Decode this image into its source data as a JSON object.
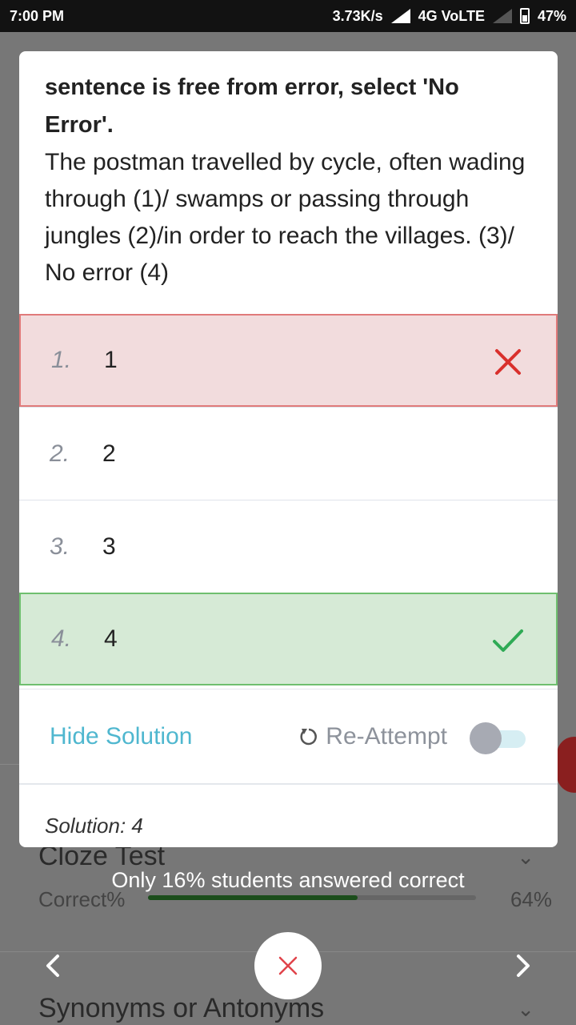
{
  "status_bar": {
    "time": "7:00 PM",
    "speed": "3.73K/s",
    "network": "4G VoLTE",
    "battery": "47%"
  },
  "question": {
    "instruction_partial": "sentence is free from error, select 'No Error'.",
    "text": "The postman travelled by cycle, often wading through (1)/ swamps or passing through jungles (2)/in order to reach the villages. (3)/ No error (4)"
  },
  "options": [
    {
      "number": "1.",
      "value": "1",
      "state": "wrong"
    },
    {
      "number": "2.",
      "value": "2",
      "state": "neutral"
    },
    {
      "number": "3.",
      "value": "3",
      "state": "neutral"
    },
    {
      "number": "4.",
      "value": "4",
      "state": "correct"
    }
  ],
  "controls": {
    "hide_solution": "Hide Solution",
    "reattempt": "Re-Attempt",
    "reattempt_toggle_on": false
  },
  "solution": {
    "text": "Solution: 4"
  },
  "background": {
    "topic1": "Cloze Test",
    "correct_label": "Correct%",
    "topic1_pct": "64%",
    "topic1_progress": 0.64,
    "topic2": "Synonyms or Antonyms"
  },
  "footer": {
    "notice": "Only 16% students answered correct"
  },
  "colors": {
    "wrong_bg": "#f2dcdd",
    "correct_bg": "#d6ead6",
    "accent": "#4fb7cf",
    "wrong_mark": "#d9302c",
    "correct_mark": "#2faa55"
  }
}
